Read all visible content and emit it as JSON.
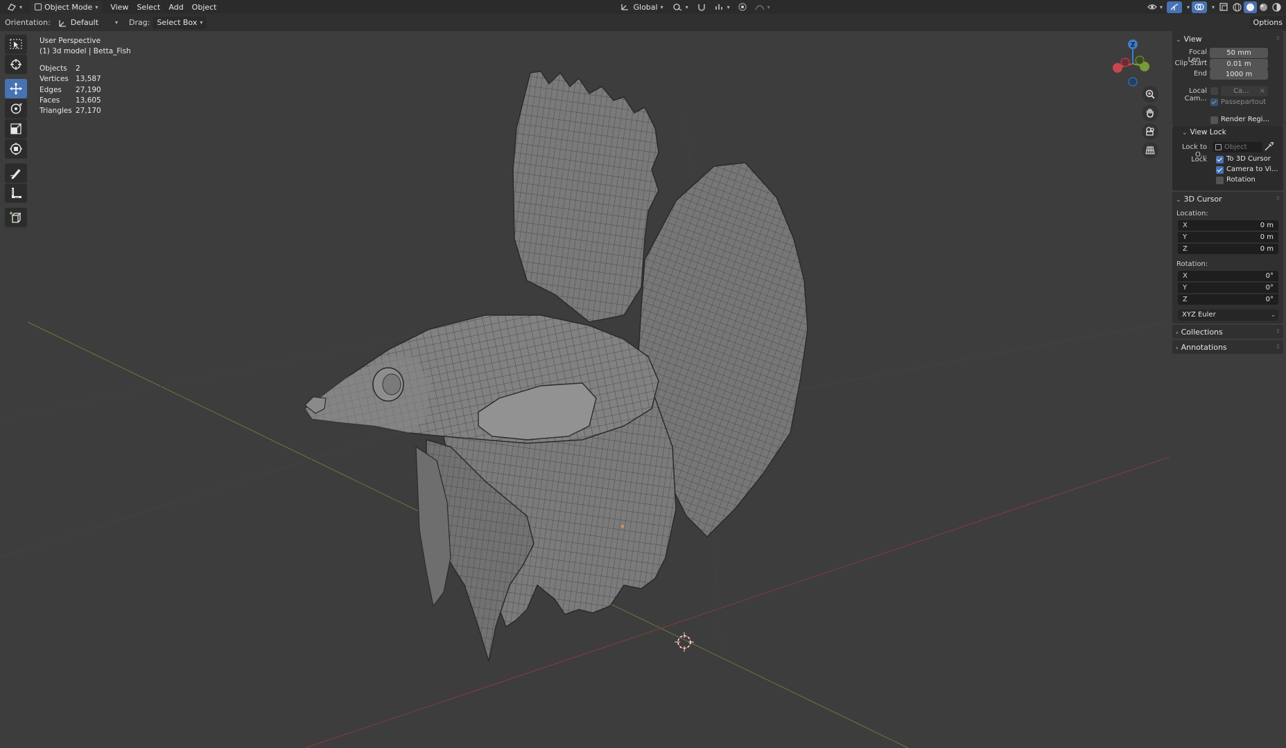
{
  "header": {
    "editor_icon": "view3d-icon",
    "mode": "Object Mode",
    "menus": [
      "View",
      "Select",
      "Add",
      "Object"
    ],
    "transform_orientation": "Global"
  },
  "tool_settings": {
    "orientation_label": "Orientation:",
    "orientation_value": "Default",
    "drag_label": "Drag:",
    "drag_value": "Select Box",
    "options_label": "Options"
  },
  "viewport": {
    "perspective": "User Perspective",
    "object_info": "(1) 3d model | Betta_Fish",
    "stats": [
      {
        "key": "Objects",
        "value": "2"
      },
      {
        "key": "Vertices",
        "value": "13,587"
      },
      {
        "key": "Edges",
        "value": "27,190"
      },
      {
        "key": "Faces",
        "value": "13,605"
      },
      {
        "key": "Triangles",
        "value": "27,170"
      }
    ],
    "gizmo_axis_label": "Z"
  },
  "toolbar": {
    "tools": [
      "select-box-tool",
      "cursor-tool",
      "move-tool",
      "rotate-tool",
      "scale-tool",
      "transform-tool",
      "annotate-tool",
      "measure-tool",
      "add-cube-tool"
    ],
    "active": "move-tool"
  },
  "npanel": {
    "view": {
      "title": "View",
      "focal_label": "Focal Len...",
      "focal_value": "50 mm",
      "clip_start_label": "Clip Start",
      "clip_start_value": "0.01 m",
      "end_label": "End",
      "end_value": "1000 m",
      "local_camera_label": "Local Cam...",
      "local_camera_value": "Ca...",
      "passepartout": "Passepartout",
      "render_region": "Render Regi..."
    },
    "view_lock": {
      "title": "View Lock",
      "lock_to_object_label": "Lock to O...",
      "lock_to_object_placeholder": "Object",
      "lock_label": "Lock",
      "to_3d_cursor": "To 3D Cursor",
      "camera_to_view": "Camera to Vi...",
      "rotation": "Rotation"
    },
    "cursor": {
      "title": "3D Cursor",
      "location_label": "Location:",
      "location": [
        {
          "axis": "X",
          "value": "0 m"
        },
        {
          "axis": "Y",
          "value": "0 m"
        },
        {
          "axis": "Z",
          "value": "0 m"
        }
      ],
      "rotation_label": "Rotation:",
      "rotation": [
        {
          "axis": "X",
          "value": "0°"
        },
        {
          "axis": "Y",
          "value": "0°"
        },
        {
          "axis": "Z",
          "value": "0°"
        }
      ],
      "rotation_mode": "XYZ Euler"
    },
    "collections": "Collections",
    "annotations": "Annotations"
  },
  "colors": {
    "accent": "#4772b3",
    "x_axis": "#c8474e",
    "y_axis": "#7a9a3a",
    "z_axis": "#3d7ec9"
  }
}
